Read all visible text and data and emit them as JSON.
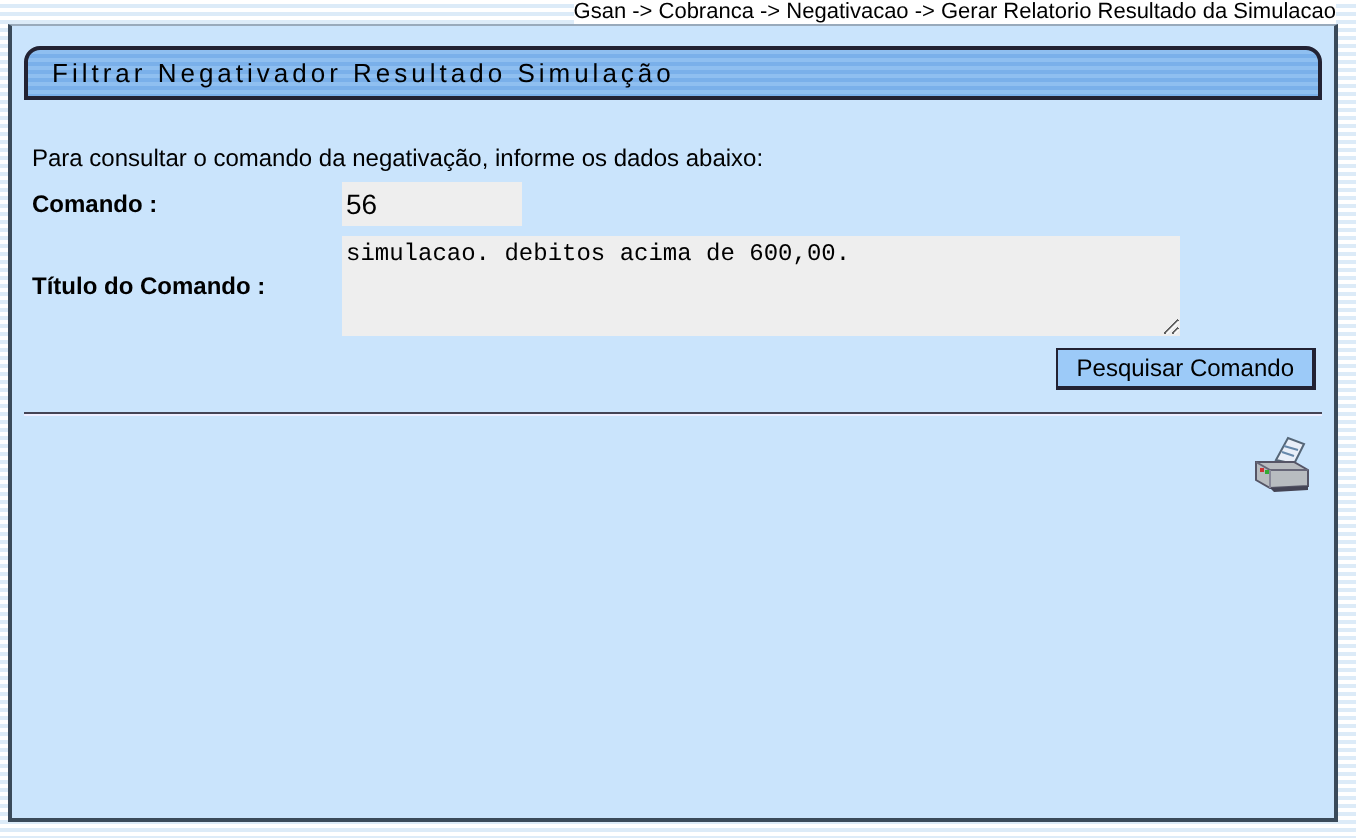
{
  "breadcrumb": "Gsan -> Cobranca -> Negativacao -> Gerar Relatorio Resultado da Simulacao",
  "panel": {
    "title": "Filtrar Negativador Resultado Simulação",
    "instructions": "Para consultar o comando da negativação, informe os dados abaixo:",
    "fields": [
      {
        "kind": "input",
        "label": "Comando :",
        "value": "56"
      },
      {
        "kind": "textarea",
        "label": "Título do Comando :",
        "value": "simulacao. debitos acima de 600,00."
      }
    ],
    "button": "Pesquisar Comando"
  }
}
